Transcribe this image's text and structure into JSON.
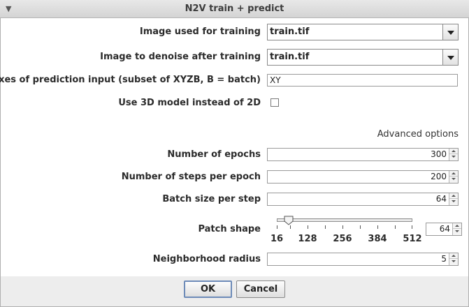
{
  "window": {
    "title": "N2V train + predict"
  },
  "fields": {
    "train_image": {
      "label": "Image used for training",
      "value": "train.tif"
    },
    "denoise_image": {
      "label": "Image to denoise after training",
      "value": "train.tif"
    },
    "axes": {
      "label": "Axes of prediction input (subset of XYZB, B = batch)",
      "value": "XY"
    },
    "use3d": {
      "label": "Use 3D model instead of 2D",
      "checked": false
    }
  },
  "advanced": {
    "label": "Advanced options"
  },
  "epochs": {
    "label": "Number of epochs",
    "value": "300"
  },
  "steps": {
    "label": "Number of steps per epoch",
    "value": "200"
  },
  "batch": {
    "label": "Batch size per step",
    "value": "64"
  },
  "patch": {
    "label": "Patch shape",
    "value": "64",
    "slider_min": 16,
    "slider_max": 512,
    "slider_value": 64,
    "ticks": [
      "16",
      "128",
      "256",
      "384",
      "512"
    ]
  },
  "neighborhood": {
    "label": "Neighborhood radius",
    "value": "5"
  },
  "buttons": {
    "ok": "OK",
    "cancel": "Cancel"
  }
}
